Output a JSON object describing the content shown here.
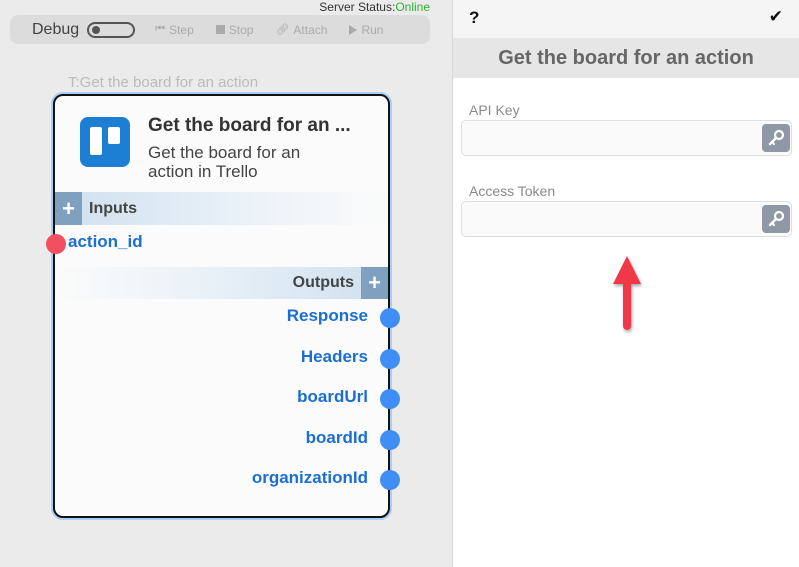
{
  "server_status": {
    "label": "Server Status:",
    "value": "Online",
    "value_color": "#2db32d"
  },
  "debug_bar": {
    "label": "Debug",
    "toggle_on": false,
    "buttons": [
      {
        "label": "Step",
        "icon": "step-icon"
      },
      {
        "label": "Stop",
        "icon": "stop-icon"
      },
      {
        "label": "Attach",
        "icon": "link-icon"
      },
      {
        "label": "Run",
        "icon": "play-icon"
      }
    ]
  },
  "node": {
    "caption": "T:Get the board for an action",
    "title": "Get the board for an ...",
    "description": "Get the board for an action in Trello",
    "icon": "trello-icon",
    "inputs_label": "Inputs",
    "inputs": [
      "action_id"
    ],
    "outputs_label": "Outputs",
    "outputs": [
      "Response",
      "Headers",
      "boardUrl",
      "boardId",
      "organizationId"
    ],
    "colors": {
      "input_port": "#f25060",
      "output_port": "#3f8ef5",
      "port_label": "#1b6fd3"
    }
  },
  "panel": {
    "help_symbol": "?",
    "confirm_symbol": "✔",
    "title": "Get the board for an action",
    "fields": [
      {
        "label": "API Key",
        "value": "",
        "icon": "key-icon"
      },
      {
        "label": "Access Token",
        "value": "",
        "icon": "key-icon"
      }
    ]
  }
}
